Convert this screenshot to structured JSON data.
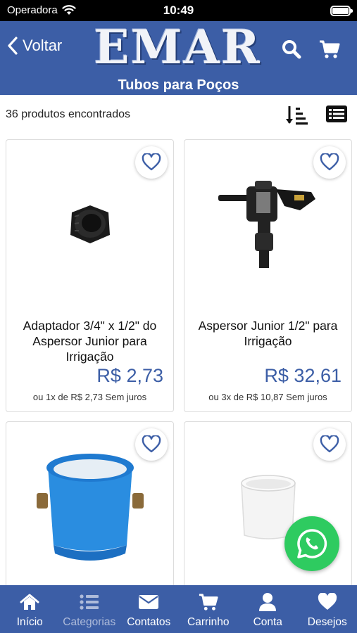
{
  "status": {
    "carrier": "Operadora",
    "time": "10:49"
  },
  "header": {
    "back_label": "Voltar",
    "logo_text": "EMAR",
    "title": "Tubos para Poços"
  },
  "toolbar": {
    "count_text": "36 produtos encontrados"
  },
  "products": [
    {
      "name": "Adaptador 3/4\" x 1/2\" do Aspersor Junior para Irrigação",
      "price": "R$ 2,73",
      "installments": "ou 1x de R$ 2,73 Sem juros"
    },
    {
      "name": "Aspersor Junior 1/2\" para Irrigação",
      "price": "R$ 32,61",
      "installments": "ou 3x de R$ 10,87 Sem juros"
    },
    {
      "name": "",
      "price": "",
      "installments": ""
    },
    {
      "name": "",
      "price": "",
      "installments": ""
    }
  ],
  "nav": {
    "items": [
      {
        "label": "Início",
        "icon": "home-icon",
        "active": true
      },
      {
        "label": "Categorias",
        "icon": "list-icon",
        "active": false
      },
      {
        "label": "Contatos",
        "icon": "envelope-icon",
        "active": true
      },
      {
        "label": "Carrinho",
        "icon": "cart-icon",
        "active": true
      },
      {
        "label": "Conta",
        "icon": "user-icon",
        "active": true
      },
      {
        "label": "Desejos",
        "icon": "heart-icon",
        "active": true
      }
    ]
  },
  "colors": {
    "brand": "#3c5ea6",
    "whatsapp": "#2ecb60",
    "price": "#3c5ea6"
  }
}
